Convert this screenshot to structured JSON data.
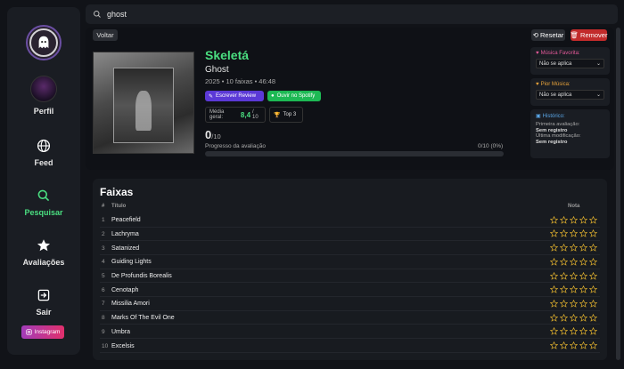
{
  "sidebar": {
    "profile_label": "Perfil",
    "feed_label": "Feed",
    "search_label": "Pesquisar",
    "reviews_label": "Avaliações",
    "logout_label": "Sair",
    "instagram_label": "Instagram"
  },
  "search": {
    "value": "ghost"
  },
  "toolbar": {
    "back_label": "Voltar",
    "reset_label": "Resetar",
    "remove_label": "Remover"
  },
  "album": {
    "title": "Skeletá",
    "artist": "Ghost",
    "meta": "2025 • 10 faixas • 46:48",
    "review_button": "Escrever Review",
    "spotify_button": "Ouvir no Spotify",
    "avg_label": "Média geral:",
    "avg_value": "8,4",
    "avg_max": "/ 10",
    "top_label": "Top 3",
    "score": "0",
    "score_max": "/10",
    "progress_label": "Progresso da avaliação",
    "progress_count": "0/10 (0%)",
    "progress_fraction": 0
  },
  "side": {
    "fav_label": "Música Favorita:",
    "fav_value": "Não se aplica",
    "worst_label": "Pior Música:",
    "worst_value": "Não se aplica",
    "hist_label": "Histórico:",
    "first_label": "Primeira avaliação:",
    "first_value": "Sem registro",
    "last_label": "Última modificação:",
    "last_value": "Sem registro"
  },
  "tracks": {
    "title": "Faixas",
    "col_num": "#",
    "col_title": "Título",
    "col_rating": "Nota",
    "items": [
      {
        "num": "1",
        "name": "Peacefield"
      },
      {
        "num": "2",
        "name": "Lachryma"
      },
      {
        "num": "3",
        "name": "Satanized"
      },
      {
        "num": "4",
        "name": "Guiding Lights"
      },
      {
        "num": "5",
        "name": "De Profundis Borealis"
      },
      {
        "num": "6",
        "name": "Cenotaph"
      },
      {
        "num": "7",
        "name": "Missilia Amori"
      },
      {
        "num": "8",
        "name": "Marks Of The Evil One"
      },
      {
        "num": "9",
        "name": "Umbra"
      },
      {
        "num": "10",
        "name": "Excelsis"
      }
    ]
  },
  "colors": {
    "accent": "#4ade80",
    "remove": "#c22b2b",
    "review": "#5b39d6",
    "spotify": "#1db954",
    "star": "#d4a72c"
  }
}
